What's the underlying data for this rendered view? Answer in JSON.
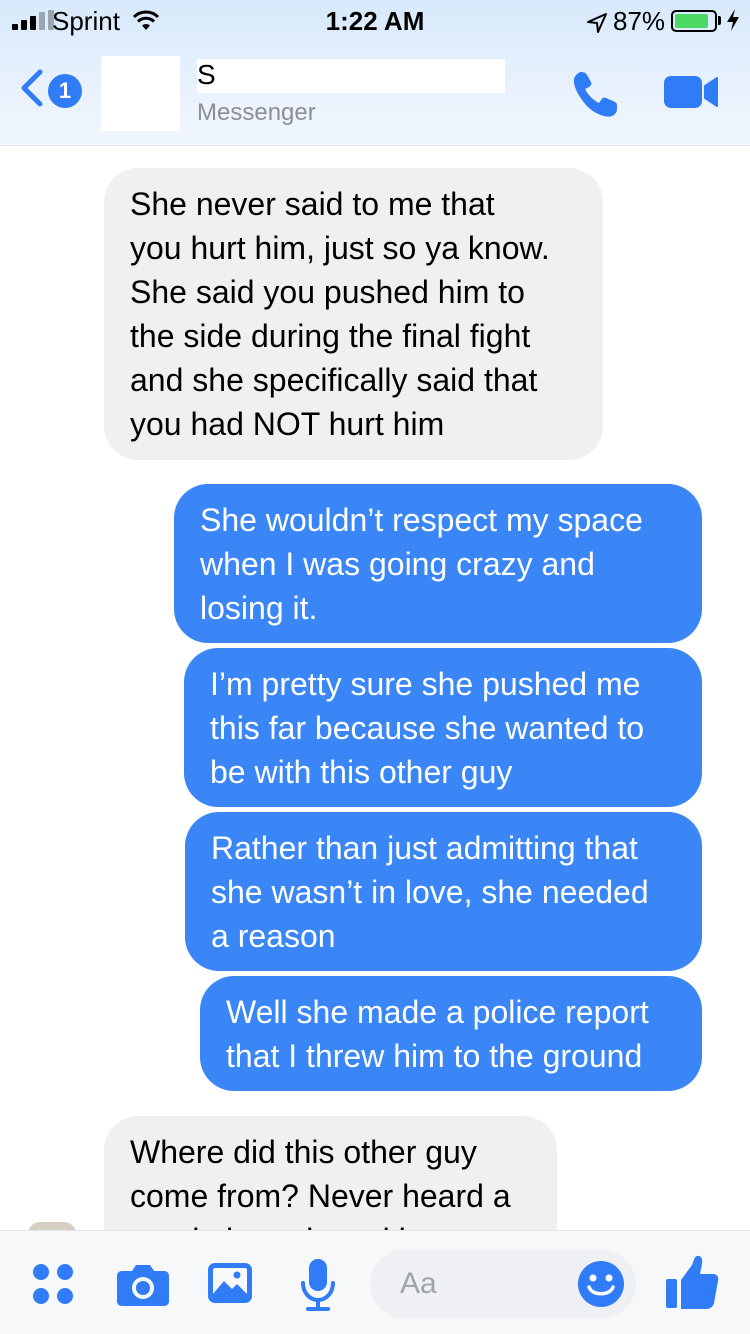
{
  "status_bar": {
    "carrier": "Sprint",
    "time": "1:22 AM",
    "battery_percent": "87%",
    "battery_level": 0.87,
    "icons": [
      "signal-icon",
      "wifi-icon",
      "location-icon",
      "battery-icon",
      "charging-bolt-icon"
    ]
  },
  "header": {
    "back_badge": "1",
    "contact_name": "S",
    "subtitle": "Messenger",
    "icons": [
      "back-chevron-icon",
      "phone-icon",
      "video-camera-icon"
    ]
  },
  "messages": [
    {
      "sender": "them",
      "text": "She never said to me that\nyou hurt him, just so ya know.\nShe said you pushed him to\nthe side during the final fight\nand she specifically said that\nyou had NOT hurt him"
    },
    {
      "sender": "me",
      "text": "She wouldn’t respect my space\nwhen I was going crazy and\nlosing it."
    },
    {
      "sender": "me",
      "text": "I’m pretty sure she pushed me\nthis far because she wanted to\nbe with this other guy"
    },
    {
      "sender": "me",
      "text": "Rather than just admitting that\nshe wasn’t in love, she needed\na reason"
    },
    {
      "sender": "me",
      "text": "Well she made a police report\nthat I threw him to the ground"
    },
    {
      "sender": "them",
      "text": "Where did this other guy\ncome from? Never heard a\nword about that with"
    }
  ],
  "composer": {
    "placeholder": "Aa",
    "icons": [
      "apps-grid-icon",
      "camera-icon",
      "gallery-icon",
      "microphone-icon",
      "emoji-icon",
      "thumbs-up-icon"
    ]
  },
  "colors": {
    "accent": "#2f7cf6",
    "outgoing_bubble": "#3a86f7",
    "incoming_bubble": "#f1f0f0"
  }
}
